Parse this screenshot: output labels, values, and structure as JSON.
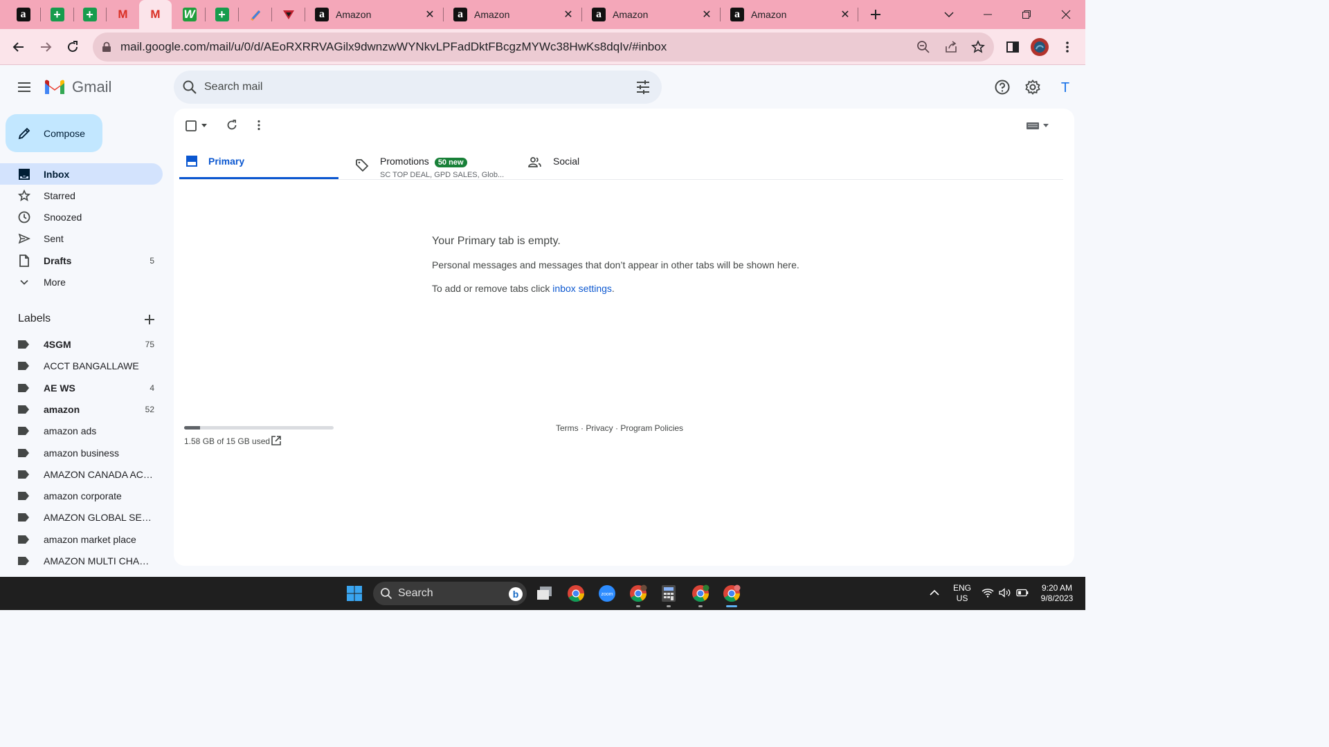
{
  "browser": {
    "pinned_tabs": [
      {
        "name": "tab-amazon-1",
        "icon": "amazon-icon",
        "glyph": "a"
      },
      {
        "name": "tab-sheets-1",
        "icon": "sheets-icon",
        "glyph": "+"
      },
      {
        "name": "tab-sheets-2",
        "icon": "sheets-icon",
        "glyph": "+"
      },
      {
        "name": "tab-gmail-1",
        "icon": "gmail-icon",
        "glyph": "M"
      },
      {
        "name": "tab-gmail-2",
        "icon": "gmail-icon",
        "glyph": "M"
      },
      {
        "name": "tab-w",
        "icon": "w-icon",
        "glyph": "W"
      },
      {
        "name": "tab-sheets-3",
        "icon": "sheets-icon",
        "glyph": "+"
      },
      {
        "name": "tab-pen",
        "icon": "pen-icon",
        "glyph": ""
      },
      {
        "name": "tab-triangle",
        "icon": "triangle-icon",
        "glyph": ""
      }
    ],
    "tabs": [
      {
        "title": "Amazon",
        "favicon": "a"
      },
      {
        "title": "Amazon",
        "favicon": "a"
      },
      {
        "title": "Amazon",
        "favicon": "a"
      },
      {
        "title": "Amazon",
        "favicon": "a"
      }
    ],
    "url": "mail.google.com/mail/u/0/d/AEoRXRRVAGilx9dwnzwWYNkvLPFadDktFBcgzMYWc38HwKs8dqIv/#inbox",
    "colors": {
      "tab_strip": "#f4a7b9",
      "toolbar": "#fbe4ea",
      "omnibox": "#eccbd3"
    }
  },
  "gmail": {
    "brand": "Gmail",
    "search_placeholder": "Search mail",
    "compose_label": "Compose",
    "nav": [
      {
        "label": "Inbox",
        "count": "",
        "icon": "inbox-icon",
        "selected": true
      },
      {
        "label": "Starred",
        "count": "",
        "icon": "star-icon"
      },
      {
        "label": "Snoozed",
        "count": "",
        "icon": "clock-icon"
      },
      {
        "label": "Sent",
        "count": "",
        "icon": "send-icon"
      },
      {
        "label": "Drafts",
        "count": "5",
        "icon": "draft-icon",
        "bold": true
      },
      {
        "label": "More",
        "count": "",
        "icon": "chevron-down-icon"
      }
    ],
    "labels_heading": "Labels",
    "labels": [
      {
        "name": "4SGM",
        "count": "75",
        "bold": true
      },
      {
        "name": "ACCT BANGALLAWE",
        "count": ""
      },
      {
        "name": "AE WS",
        "count": "4",
        "bold": true
      },
      {
        "name": "amazon",
        "count": "52",
        "bold": true
      },
      {
        "name": "amazon ads",
        "count": ""
      },
      {
        "name": "amazon business",
        "count": ""
      },
      {
        "name": "AMAZON CANADA ACCT",
        "count": ""
      },
      {
        "name": "amazon corporate",
        "count": ""
      },
      {
        "name": "AMAZON GLOBAL SELL...",
        "count": ""
      },
      {
        "name": "amazon market place",
        "count": ""
      },
      {
        "name": "AMAZON MULTI CHANN...",
        "count": ""
      }
    ],
    "tabs": {
      "primary": "Primary",
      "promotions": "Promotions",
      "promotions_badge": "50 new",
      "promotions_sub": "SC TOP DEAL, GPD SALES, Glob...",
      "social": "Social"
    },
    "empty": {
      "title": "Your Primary tab is empty.",
      "body": "Personal messages and messages that don’t appear in other tabs will be shown here.",
      "tip_prefix": "To add or remove tabs click ",
      "tip_link": "inbox settings",
      "tip_suffix": "."
    },
    "storage": {
      "text": "1.58 GB of 15 GB used",
      "fraction": 0.105
    },
    "footer": "Terms · Privacy · Program Policies",
    "account_initial": "T",
    "colors": {
      "accent": "#0b57d0",
      "compose_bg": "#c2e7ff",
      "selected_nav": "#d3e3fd",
      "badge": "#188038"
    }
  },
  "taskbar": {
    "search_label": "Search",
    "lang_line1": "ENG",
    "lang_line2": "US",
    "time": "9:20 AM",
    "date": "9/8/2023"
  }
}
